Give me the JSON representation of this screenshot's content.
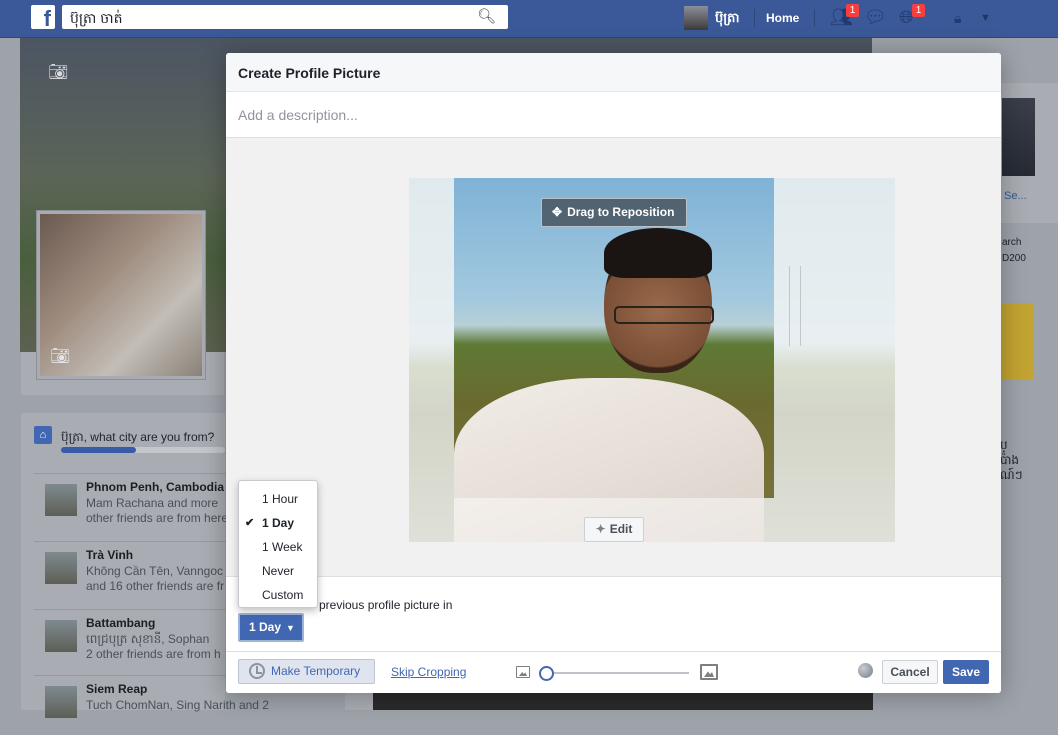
{
  "topbar": {
    "logo": "f",
    "search_value": "ប៊ុត្រា ចាត់",
    "search_icon": "search-icon",
    "username": "ប៊ុត្រា",
    "home_label": "Home",
    "friend_requests_badge": "1",
    "notifications_badge": "1",
    "colors": {
      "bar": "#3b5998",
      "badge": "#fa3e3e"
    }
  },
  "background": {
    "city_prompt": {
      "question": "ប៊ុត្រា, what city are you from?",
      "items": [
        {
          "name": "Phnom Penh, Cambodia",
          "desc_line1": "Mam Rachana and more",
          "desc_line2": "other friends are from here"
        },
        {
          "name": "Trà Vinh",
          "desc_line1": "Không Cần Tên, Vanngoc",
          "desc_line2": "and 16 other friends are fr"
        },
        {
          "name": "Battambang",
          "desc_line1": "ពេជ្របុត្រ សុខានី, Sophan",
          "desc_line2": "2 other friends are from h"
        },
        {
          "name": "Siem Reap",
          "desc_line1": "Tuch ChomNan, Sing Narith and 2",
          "desc_line2": ""
        }
      ]
    },
    "right_column": {
      "person_name": "Se...",
      "text_line1": "arch",
      "text_line2": "D200",
      "khmer_line1": "ប្",
      "khmer_line2": "ប៉ាង",
      "khmer_line3": "ណ៍ៗ"
    }
  },
  "modal": {
    "title": "Create Profile Picture",
    "description_placeholder": "Add a description...",
    "drag_label": "Drag to Reposition",
    "edit_label": "Edit",
    "temporary_text": "previous profile picture in",
    "duration_button": "1 Day",
    "duration_options": [
      {
        "label": "1 Hour",
        "selected": false
      },
      {
        "label": "1 Day",
        "selected": true
      },
      {
        "label": "1 Week",
        "selected": false
      },
      {
        "label": "Never",
        "selected": false
      },
      {
        "label": "Custom",
        "selected": false
      }
    ],
    "footer": {
      "make_temporary": "Make Temporary",
      "skip_cropping": "Skip Cropping",
      "zoom_level": 0,
      "cancel": "Cancel",
      "save": "Save"
    },
    "colors": {
      "primary": "#4267b2",
      "link": "#4267b2"
    }
  }
}
